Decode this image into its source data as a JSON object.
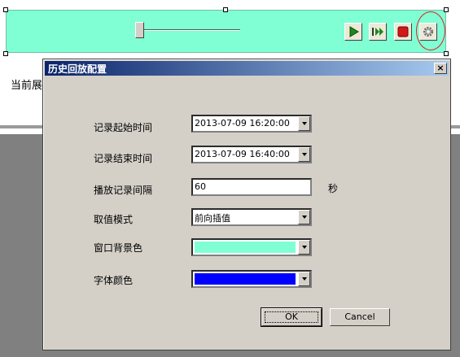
{
  "player": {
    "progress": 0,
    "buttons": [
      {
        "name": "play",
        "icon": "play-icon"
      },
      {
        "name": "fast-forward",
        "icon": "fast-forward-icon"
      },
      {
        "name": "stop",
        "icon": "stop-icon"
      },
      {
        "name": "settings",
        "icon": "gear-icon"
      }
    ],
    "background_color": "#80ffd4"
  },
  "background_text": "当前展",
  "dialog": {
    "title": "历史回放配置",
    "close_label": "×",
    "fields": {
      "start_time": {
        "label": "记录起始时间",
        "value": "2013-07-09 16:20:00"
      },
      "end_time": {
        "label": "记录结束时间",
        "value": "2013-07-09 16:40:00"
      },
      "interval": {
        "label": "播放记录间隔",
        "value": "60",
        "unit": "秒"
      },
      "mode": {
        "label": "取值模式",
        "value": "前向插值"
      },
      "window_bg": {
        "label": "窗口背景色",
        "color": "#80ffd4"
      },
      "font_color": {
        "label": "字体颜色",
        "color": "#0000ff"
      }
    },
    "ok_label": "OK",
    "cancel_label": "Cancel"
  }
}
